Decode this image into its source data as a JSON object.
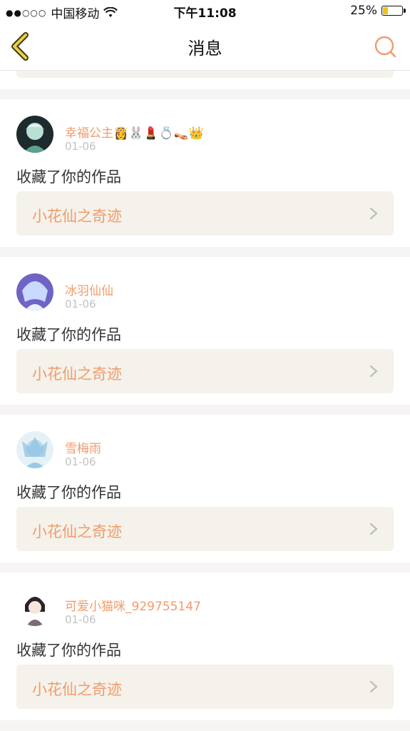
{
  "status_bar": {
    "signal": "●●○○○",
    "carrier": "中国移动",
    "time": "下午11:08",
    "battery": "25%",
    "battery_level": 0.25,
    "battery_color": "#f1c40f"
  },
  "nav": {
    "title": "消息",
    "back_icon": "back-chevron-icon",
    "search_icon": "search-icon",
    "accent": "#f29b6b"
  },
  "messages": [
    {
      "user": "幸福公主👸🐰💄💍👡👑",
      "date": "01-06",
      "action": "收藏了你的作品",
      "work": "小花仙之奇迹"
    },
    {
      "user": "冰羽仙仙",
      "date": "01-06",
      "action": "收藏了你的作品",
      "work": "小花仙之奇迹"
    },
    {
      "user": "雪梅雨",
      "date": "01-06",
      "action": "收藏了你的作品",
      "work": "小花仙之奇迹"
    },
    {
      "user": "可爱小猫咪_929755147",
      "date": "01-06",
      "action": "收藏了你的作品",
      "work": "小花仙之奇迹"
    }
  ]
}
